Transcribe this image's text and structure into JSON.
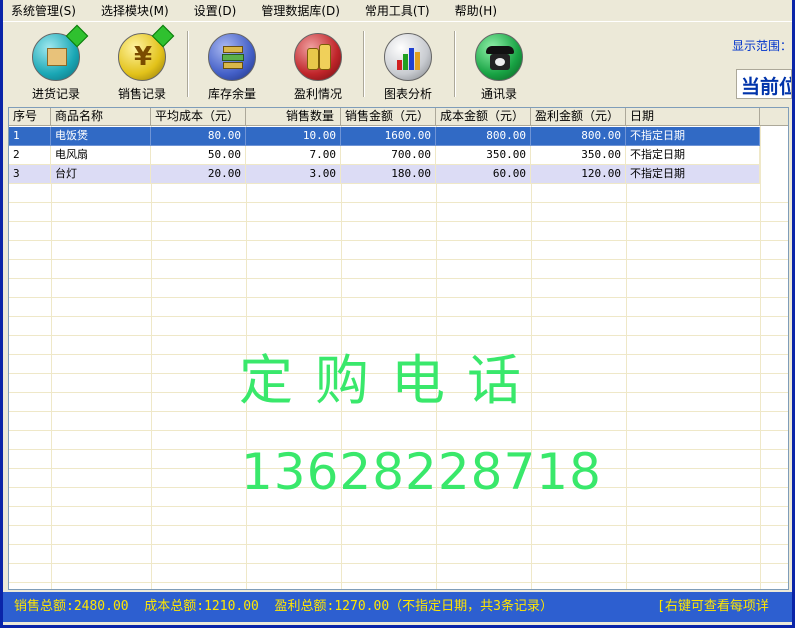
{
  "menu": [
    "系统管理(S)",
    "选择模块(M)",
    "设置(D)",
    "管理数据库(D)",
    "常用工具(T)",
    "帮助(H)"
  ],
  "toolbar": {
    "items": [
      {
        "label": "进货记录",
        "icon": "box-import-icon",
        "color": "#1aa7b5"
      },
      {
        "label": "销售记录",
        "icon": "yen-coin-icon",
        "color": "#e2c21a"
      },
      {
        "label": "库存余量",
        "icon": "books-stack-icon",
        "color": "#4460c8"
      },
      {
        "label": "盈利情况",
        "icon": "coin-stack-icon",
        "color": "#c0252a"
      },
      {
        "label": "图表分析",
        "icon": "bar-chart-icon",
        "color": "#b9bcc0"
      },
      {
        "label": "通讯录",
        "icon": "telephone-icon",
        "color": "#18a344"
      }
    ],
    "range_label": "显示范围：",
    "position_text": "当前位"
  },
  "table": {
    "columns": [
      "序号",
      "商品名称",
      "平均成本（元）",
      "销售数量",
      "销售金额（元）",
      "成本金额（元）",
      "盈利金额（元）",
      "日期"
    ],
    "rows": [
      [
        "1",
        "电饭煲",
        "80.00",
        "10.00",
        "1600.00",
        "800.00",
        "800.00",
        "不指定日期"
      ],
      [
        "2",
        "电风扇",
        "50.00",
        "7.00",
        "700.00",
        "350.00",
        "350.00",
        "不指定日期"
      ],
      [
        "3",
        "台灯",
        "20.00",
        "3.00",
        "180.00",
        "60.00",
        "120.00",
        "不指定日期"
      ]
    ],
    "selected_row": 0
  },
  "watermark": {
    "title": "定购电话",
    "phone": "13628228718"
  },
  "status": {
    "summary": "销售总额:2480.00  成本总额:1210.00  盈利总额:1270.00（不指定日期，共3条记录）",
    "hint": "[右键可查看每项详"
  },
  "colors": {
    "selected": "#316ac5",
    "alt_row": "#dcdcf5",
    "watermark": "#39e86b",
    "status_bg": "#2d5fd0",
    "status_text": "#ffe600"
  }
}
